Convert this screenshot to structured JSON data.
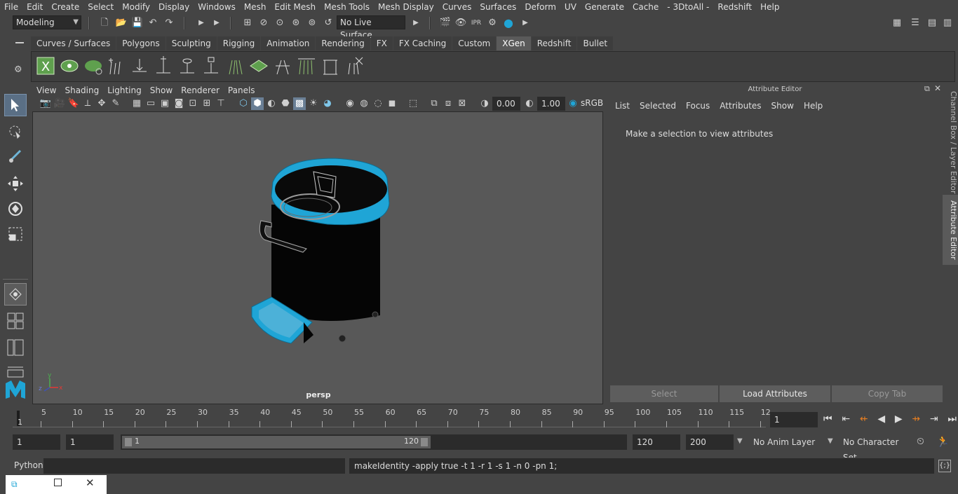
{
  "menubar": {
    "items": [
      "File",
      "Edit",
      "Create",
      "Select",
      "Modify",
      "Display",
      "Windows",
      "Mesh",
      "Edit Mesh",
      "Mesh Tools",
      "Mesh Display",
      "Curves",
      "Surfaces",
      "Deform",
      "UV",
      "Generate",
      "Cache",
      "- 3DtoAll -",
      "Redshift",
      "Help"
    ]
  },
  "statusline": {
    "mode": "Modeling",
    "live_surface": "No Live Surface"
  },
  "shelf": {
    "tabs": [
      "Curves / Surfaces",
      "Polygons",
      "Sculpting",
      "Rigging",
      "Animation",
      "Rendering",
      "FX",
      "FX Caching",
      "Custom",
      "XGen",
      "Redshift",
      "Bullet"
    ],
    "active_tab": "XGen"
  },
  "viewport": {
    "menu": [
      "View",
      "Shading",
      "Lighting",
      "Show",
      "Renderer",
      "Panels"
    ],
    "exposure": "0.00",
    "gamma": "1.00",
    "color_space": "sRGB",
    "camera_label": "persp",
    "axis_labels": {
      "y": "y",
      "x": "x",
      "z": "z"
    }
  },
  "attribute_editor": {
    "title": "Attribute Editor",
    "menu": [
      "List",
      "Selected",
      "Focus",
      "Attributes",
      "Show",
      "Help"
    ],
    "message": "Make a selection to view attributes",
    "buttons": {
      "select": "Select",
      "load": "Load Attributes",
      "copy": "Copy Tab"
    }
  },
  "side_tabs": {
    "channel_box": "Channel Box / Layer Editor",
    "attribute_editor": "Attribute Editor"
  },
  "timeslider": {
    "start_label": "1",
    "labels": [
      "5",
      "10",
      "15",
      "20",
      "25",
      "30",
      "35",
      "40",
      "45",
      "50",
      "55",
      "60",
      "65",
      "70",
      "75",
      "80",
      "85",
      "90",
      "95",
      "100",
      "105",
      "110",
      "115",
      "12"
    ],
    "current_frame": "1"
  },
  "range": {
    "start": "1",
    "playback_start": "1",
    "slider_start": "1",
    "slider_end": "120",
    "playback_end": "120",
    "end": "200",
    "anim_layer": "No Anim Layer",
    "character_set": "No Character Set"
  },
  "command_line": {
    "language": "Python",
    "output": "makeIdentity -apply true -t 1 -r 1 -s 1 -n 0 -pn 1;"
  },
  "colors": {
    "accent": "#1fa5d6",
    "ui_bg": "#444444",
    "viewport_bg": "#585858"
  }
}
